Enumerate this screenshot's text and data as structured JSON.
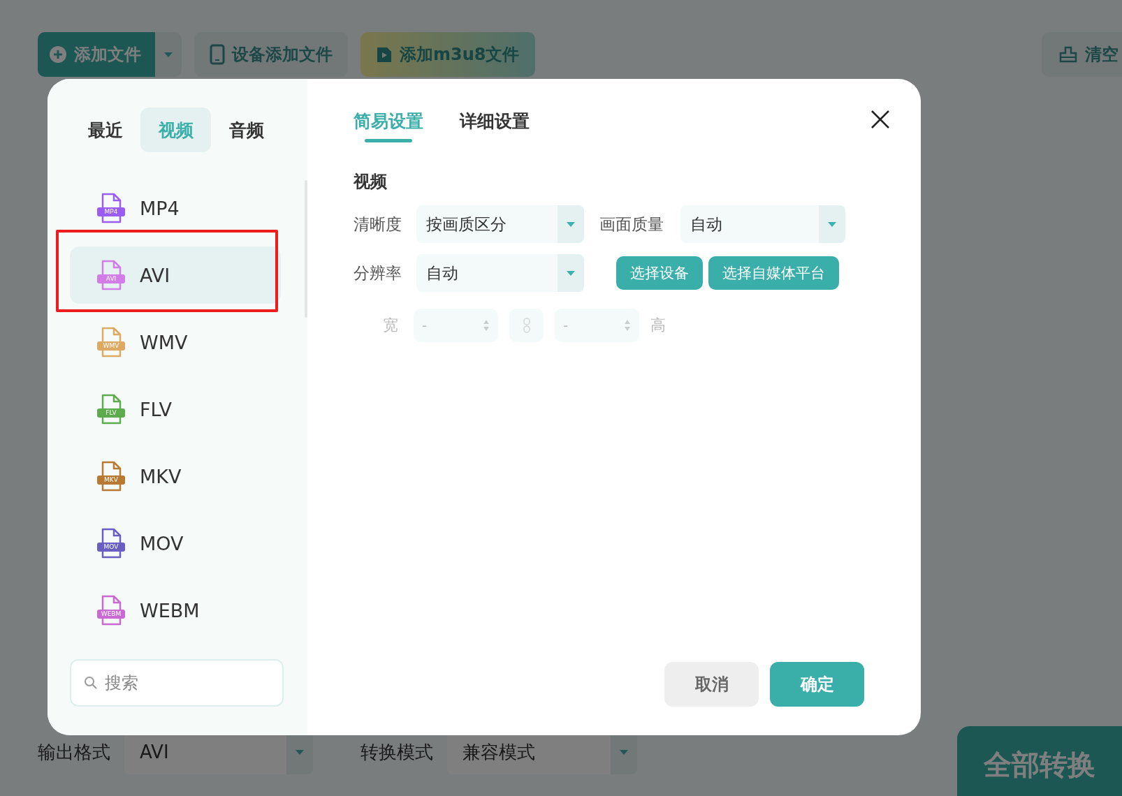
{
  "toolbar": {
    "buttons": [
      {
        "kind": "add",
        "label": "添加文件"
      },
      {
        "kind": "device",
        "label": "设备添加文件"
      },
      {
        "kind": "m3u8",
        "label": "添加m3u8文件"
      },
      {
        "kind": "clear",
        "label": "清空"
      }
    ]
  },
  "dialog": {
    "categories": [
      {
        "label": "最近",
        "selected": false
      },
      {
        "label": "视频",
        "selected": true
      },
      {
        "label": "音频",
        "selected": false
      }
    ],
    "formats": [
      {
        "name": "MP4",
        "badge": "MP4",
        "color": "#9a5cf2",
        "selected": false,
        "highlighted": false
      },
      {
        "name": "AVI",
        "badge": "AVI",
        "color": "#d27ce8",
        "selected": true,
        "highlighted": true
      },
      {
        "name": "WMV",
        "badge": "WMV",
        "color": "#dcaa62",
        "selected": false,
        "highlighted": false
      },
      {
        "name": "FLV",
        "badge": "FLV",
        "color": "#5cab4c",
        "selected": false,
        "highlighted": false
      },
      {
        "name": "MKV",
        "badge": "MKV",
        "color": "#b87a32",
        "selected": false,
        "highlighted": false
      },
      {
        "name": "MOV",
        "badge": "MOV",
        "color": "#6a5ec2",
        "selected": false,
        "highlighted": false
      },
      {
        "name": "WEBM",
        "badge": "WEBM",
        "color": "#c86ad2",
        "selected": false,
        "highlighted": false
      }
    ],
    "search": {
      "placeholder": "搜索"
    },
    "tabs": [
      {
        "label": "简易设置",
        "selected": true
      },
      {
        "label": "详细设置",
        "selected": false
      }
    ],
    "section_title": "视频",
    "fields": [
      {
        "label": "清晰度",
        "value": "按画质区分"
      },
      {
        "label": "画面质量",
        "value": "自动"
      },
      {
        "label": "分辨率",
        "value": "自动"
      }
    ],
    "action_buttons": [
      "选择设备",
      "选择自媒体平台"
    ],
    "size": {
      "width_label": "宽",
      "width_value": "-",
      "height_value": "-",
      "height_label": "高",
      "disabled": true
    },
    "buttons": [
      {
        "kind": "secondary",
        "label": "取消"
      },
      {
        "kind": "primary",
        "label": "确定"
      }
    ]
  },
  "bottom_bar": {
    "output_format": {
      "label": "输出格式",
      "value": "AVI"
    },
    "mode": {
      "label": "转换模式",
      "value": "兼容模式"
    },
    "convert_button": "全部转换"
  }
}
